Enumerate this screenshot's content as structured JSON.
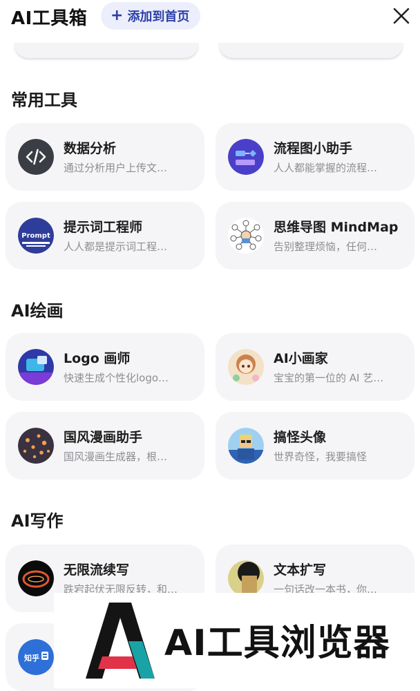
{
  "header": {
    "title": "AI工具箱",
    "add_label": "添加到首页"
  },
  "sections": [
    {
      "title": "常用工具",
      "items": [
        {
          "name": "数据分析",
          "desc": "通过分析用户上传文…"
        },
        {
          "name": "流程图小助手",
          "desc": "人人都能掌握的流程…"
        },
        {
          "name": "提示词工程师",
          "desc": "人人都是提示词工程…",
          "icon_text": "Prompt"
        },
        {
          "name": "思维导图 MindMap",
          "desc": "告别整理烦恼，任何…"
        }
      ]
    },
    {
      "title": "AI绘画",
      "items": [
        {
          "name": "Logo 画师",
          "desc": "快速生成个性化logo…"
        },
        {
          "name": "AI小画家",
          "desc": "宝宝的第一位的 AI 艺…"
        },
        {
          "name": "国风漫画助手",
          "desc": "国风漫画生成器，根…"
        },
        {
          "name": "搞怪头像",
          "desc": "世界奇怪，我要搞怪"
        }
      ]
    },
    {
      "title": "AI写作",
      "items": [
        {
          "name": "无限流续写",
          "desc": "跌宕起伏无限反转，和…"
        },
        {
          "name": "文本扩写",
          "desc": "一句话改一本书，你…"
        },
        {
          "name": "",
          "desc": "",
          "icon_text": "知乎"
        }
      ]
    }
  ],
  "watermark": {
    "text": "AI工具浏览器"
  },
  "colors": {
    "accent": "#2b3ea8",
    "card_bg": "#f5f5f7",
    "muted": "#8e8e93"
  }
}
